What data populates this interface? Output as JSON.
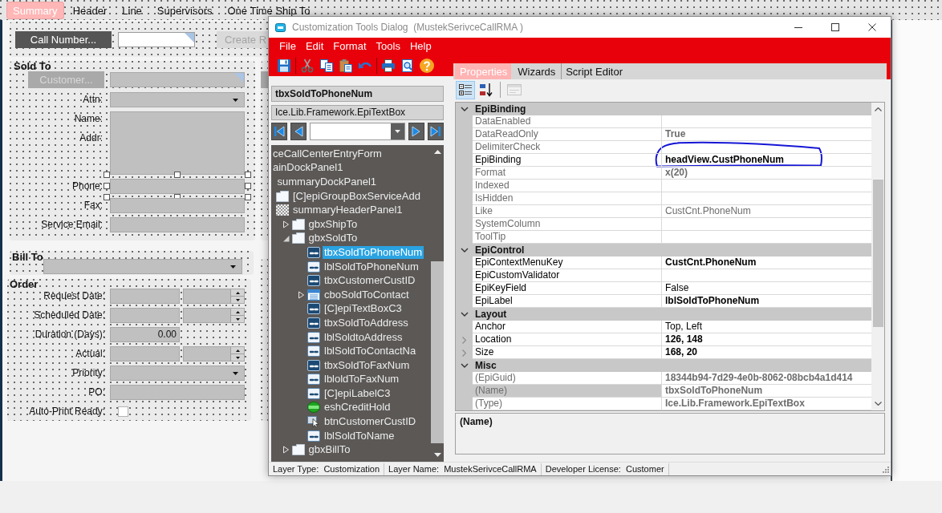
{
  "form_tabs": [
    {
      "label": "Summary",
      "selected": true
    },
    {
      "label": "Header",
      "selected": false
    },
    {
      "label": "Line",
      "selected": false
    },
    {
      "label": "Supervisors",
      "selected": false
    },
    {
      "label": "One Time Ship To",
      "selected": false
    }
  ],
  "header_panel": {
    "call_number_button": {
      "label": "Call Number...",
      "disabled": false
    },
    "call_number_field": {
      "marked": true
    },
    "create_button": {
      "label": "Create R",
      "disabled": true
    }
  },
  "sold_to": {
    "title": "Sold To",
    "customer_button": {
      "label": "Customer...",
      "disabled": true
    },
    "customer_field": {
      "marked": true
    },
    "rows": [
      {
        "labels": [
          "Attn:"
        ],
        "kind": "combo",
        "selected": false
      },
      {
        "labels": [
          "Name:",
          "Addr:"
        ],
        "kind": "memo",
        "selected": false
      },
      {
        "labels": [
          "Phone:"
        ],
        "kind": "text",
        "selected": true
      },
      {
        "labels": [
          "Fax:"
        ],
        "kind": "text",
        "selected": false
      },
      {
        "labels": [
          "Service Email:"
        ],
        "kind": "text",
        "selected": false
      }
    ]
  },
  "bill_to": {
    "title": "Bill To"
  },
  "order": {
    "title": "Order",
    "rows": [
      {
        "label": "Request Date:",
        "kind": "datetime"
      },
      {
        "label": "Scheduled Date:",
        "kind": "datetime"
      },
      {
        "label": "Duration (Days):",
        "kind": "number",
        "value": "0.00"
      },
      {
        "label": "Actual:",
        "kind": "datetime"
      },
      {
        "label": "Priority:",
        "kind": "combo"
      },
      {
        "label": "PO:",
        "kind": "text"
      },
      {
        "label": "Auto-Print Ready:",
        "kind": "checkbox",
        "checked": false
      }
    ]
  },
  "dialog": {
    "title": "Customization Tools Dialog  (MustekSerivceCallRMA )",
    "menu": [
      "File",
      "Edit",
      "Format",
      "Tools",
      "Help"
    ],
    "toolbar": [
      {
        "kind": "save"
      },
      {
        "kind": "separator"
      },
      {
        "kind": "cut"
      },
      {
        "kind": "copy"
      },
      {
        "kind": "paste"
      },
      {
        "kind": "undo"
      },
      {
        "kind": "separator"
      },
      {
        "kind": "print"
      },
      {
        "kind": "preview"
      },
      {
        "kind": "help"
      }
    ],
    "control_name": "tbxSoldToPhoneNum",
    "control_type": "Ice.Lib.Framework.EpiTextBox",
    "tree": [
      {
        "label": "ceCallCenterEntryForm",
        "selected": false,
        "children": [
          {
            "label": "ainDockPanel1",
            "selected": false,
            "children": [
              {
                "label": "summaryDockPanel1",
                "selected": false,
                "children": [
                  {
                    "label": "[C]epiGroupBoxServiceAdd",
                    "kind": "groupbox",
                    "selected": false
                  },
                  {
                    "label": "summaryHeaderPanel1",
                    "kind": "panel",
                    "selected": false,
                    "children": [
                      {
                        "label": "gbxShipTo",
                        "kind": "groupbox",
                        "expanded": false,
                        "selected": false
                      },
                      {
                        "label": "gbxSoldTo",
                        "kind": "groupbox",
                        "expanded": true,
                        "selected": false,
                        "children": [
                          {
                            "label": "tbxSoldToPhoneNum",
                            "kind": "textbox",
                            "selected": true
                          },
                          {
                            "label": "lblSoldToPhoneNum",
                            "kind": "label",
                            "selected": false
                          },
                          {
                            "label": "tbxCustomerCustID",
                            "kind": "textbox",
                            "selected": false
                          },
                          {
                            "label": "cboSoldToContact",
                            "kind": "combo",
                            "expanded": false,
                            "selected": false
                          },
                          {
                            "label": "[C]epiTextBoxC3",
                            "kind": "textbox",
                            "selected": false
                          },
                          {
                            "label": "tbxSoldToAddress",
                            "kind": "textbox",
                            "selected": false
                          },
                          {
                            "label": "lblSoldtoAddress",
                            "kind": "label",
                            "selected": false
                          },
                          {
                            "label": "lblSoldToContactNa",
                            "kind": "label",
                            "selected": false
                          },
                          {
                            "label": "tbxSoldToFaxNum",
                            "kind": "textbox",
                            "selected": false
                          },
                          {
                            "label": "lbloldToFaxNum",
                            "kind": "label",
                            "selected": false
                          },
                          {
                            "label": "[C]epiLabelC3",
                            "kind": "label",
                            "selected": false
                          },
                          {
                            "label": "eshCreditHold",
                            "kind": "shape",
                            "selected": false
                          },
                          {
                            "label": "btnCustomerCustID",
                            "kind": "button",
                            "selected": false
                          },
                          {
                            "label": "lblSoldToName",
                            "kind": "label",
                            "selected": false
                          }
                        ]
                      },
                      {
                        "label": "gbxBillTo",
                        "kind": "groupbox",
                        "expanded": false,
                        "selected": false
                      }
                    ]
                  }
                ]
              }
            ]
          }
        ]
      }
    ],
    "properties": {
      "tabs": [
        {
          "label": "Properties",
          "selected": true
        },
        {
          "label": "Wizards",
          "selected": false
        },
        {
          "label": "Script Editor",
          "selected": false
        }
      ],
      "view_buttons": [
        {
          "kind": "categorized",
          "selected": true,
          "disabled": false
        },
        {
          "kind": "alphabetical",
          "selected": false,
          "disabled": false
        },
        {
          "kind": "pages",
          "selected": false,
          "disabled": true
        }
      ],
      "categories": [
        {
          "name": "EpiBinding",
          "expanded": true,
          "rows": [
            {
              "name": "DataEnabled",
              "readonly": true,
              "selected": false,
              "circled": false
            },
            {
              "name": "DataReadOnly",
              "value": "True",
              "readonly": true,
              "modified": true,
              "selected": false,
              "circled": false
            },
            {
              "name": "DelimiterCheck",
              "readonly": true,
              "selected": false,
              "circled": false
            },
            {
              "name": "EpiBinding",
              "value": "headView.CustPhoneNum",
              "readonly": false,
              "modified": true,
              "selected": false,
              "circled": true
            },
            {
              "name": "Format",
              "value": "x(20)",
              "readonly": true,
              "modified": true,
              "selected": false,
              "circled": false
            },
            {
              "name": "Indexed",
              "readonly": true,
              "selected": false,
              "circled": false
            },
            {
              "name": "IsHidden",
              "readonly": true,
              "selected": false,
              "circled": false
            },
            {
              "name": "Like",
              "value": "CustCnt.PhoneNum",
              "readonly": true,
              "modified": false,
              "selected": false,
              "circled": false
            },
            {
              "name": "SystemColumn",
              "readonly": true,
              "selected": false,
              "circled": false
            },
            {
              "name": "ToolTip",
              "readonly": true,
              "selected": false,
              "circled": false
            }
          ]
        },
        {
          "name": "EpiControl",
          "expanded": true,
          "rows": [
            {
              "name": "EpiContextMenuKey",
              "value": "CustCnt.PhoneNum",
              "readonly": false,
              "modified": true,
              "selected": false,
              "circled": false
            },
            {
              "name": "EpiCustomValidator",
              "readonly": false,
              "selected": false,
              "circled": false
            },
            {
              "name": "EpiKeyField",
              "value": "False",
              "readonly": false,
              "modified": false,
              "selected": false,
              "circled": false
            },
            {
              "name": "EpiLabel",
              "value": "lblSoldToPhoneNum",
              "readonly": false,
              "modified": true,
              "selected": false,
              "circled": false
            }
          ]
        },
        {
          "name": "Layout",
          "expanded": true,
          "rows": [
            {
              "name": "Anchor",
              "value": "Top, Left",
              "readonly": false,
              "modified": false,
              "selected": false,
              "circled": false
            },
            {
              "name": "Location",
              "value": "126, 148",
              "readonly": false,
              "modified": true,
              "selected": false,
              "circled": false,
              "expanded": false
            },
            {
              "name": "Size",
              "value": "168, 20",
              "readonly": false,
              "modified": true,
              "selected": false,
              "circled": false,
              "expanded": false
            }
          ]
        },
        {
          "name": "Misc",
          "expanded": true,
          "rows": [
            {
              "name": "(EpiGuid)",
              "value": "18344b94-7d29-4e0b-8062-08bcb4a1d414",
              "readonly": true,
              "modified": true,
              "selected": false,
              "circled": false
            },
            {
              "name": "(Name)",
              "value": "tbxSoldToPhoneNum",
              "readonly": true,
              "modified": true,
              "selected": true,
              "circled": false
            },
            {
              "name": "(Type)",
              "value": "Ice.Lib.Framework.EpiTextBox",
              "readonly": true,
              "modified": true,
              "selected": false,
              "circled": false
            }
          ]
        }
      ],
      "description": {
        "title": "(Name)"
      }
    },
    "status_bar": [
      "Layer Type:  Customization",
      "Layer Name:  MustekSerivceCallRMA",
      "Developer License:  Customer"
    ]
  }
}
